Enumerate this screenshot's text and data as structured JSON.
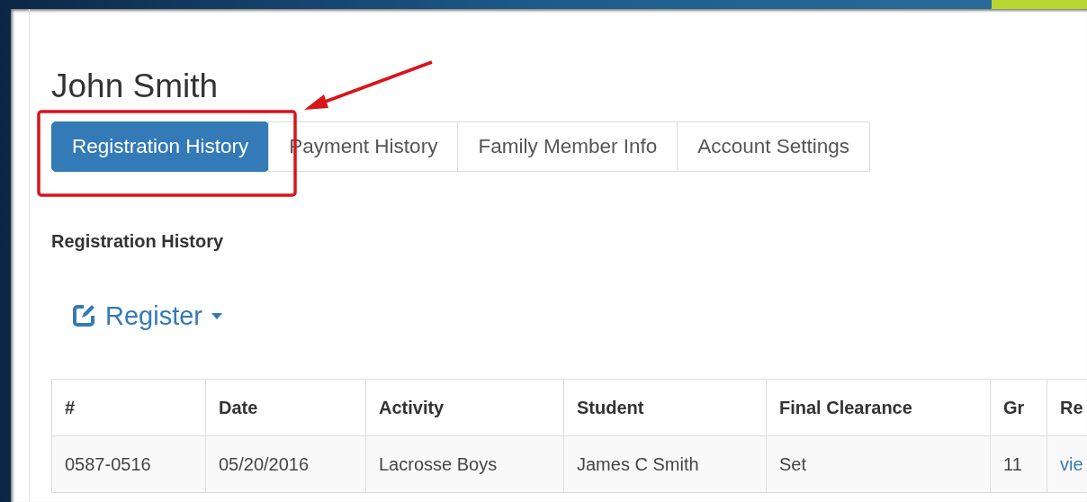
{
  "user_name": "John Smith",
  "tabs": [
    {
      "label": "Registration History",
      "selected": true
    },
    {
      "label": "Payment History",
      "selected": false
    },
    {
      "label": "Family Member Info",
      "selected": false
    },
    {
      "label": "Account Settings",
      "selected": false
    }
  ],
  "section_title": "Registration History",
  "register_button": {
    "label": "Register"
  },
  "table": {
    "columns": [
      "#",
      "Date",
      "Activity",
      "Student",
      "Final Clearance",
      "Gr",
      "Re"
    ],
    "rows": [
      {
        "cells": [
          "0587-0516",
          "05/20/2016",
          "Lacrosse Boys",
          "James C Smith",
          "Set",
          "11"
        ],
        "link": "vie"
      }
    ]
  }
}
